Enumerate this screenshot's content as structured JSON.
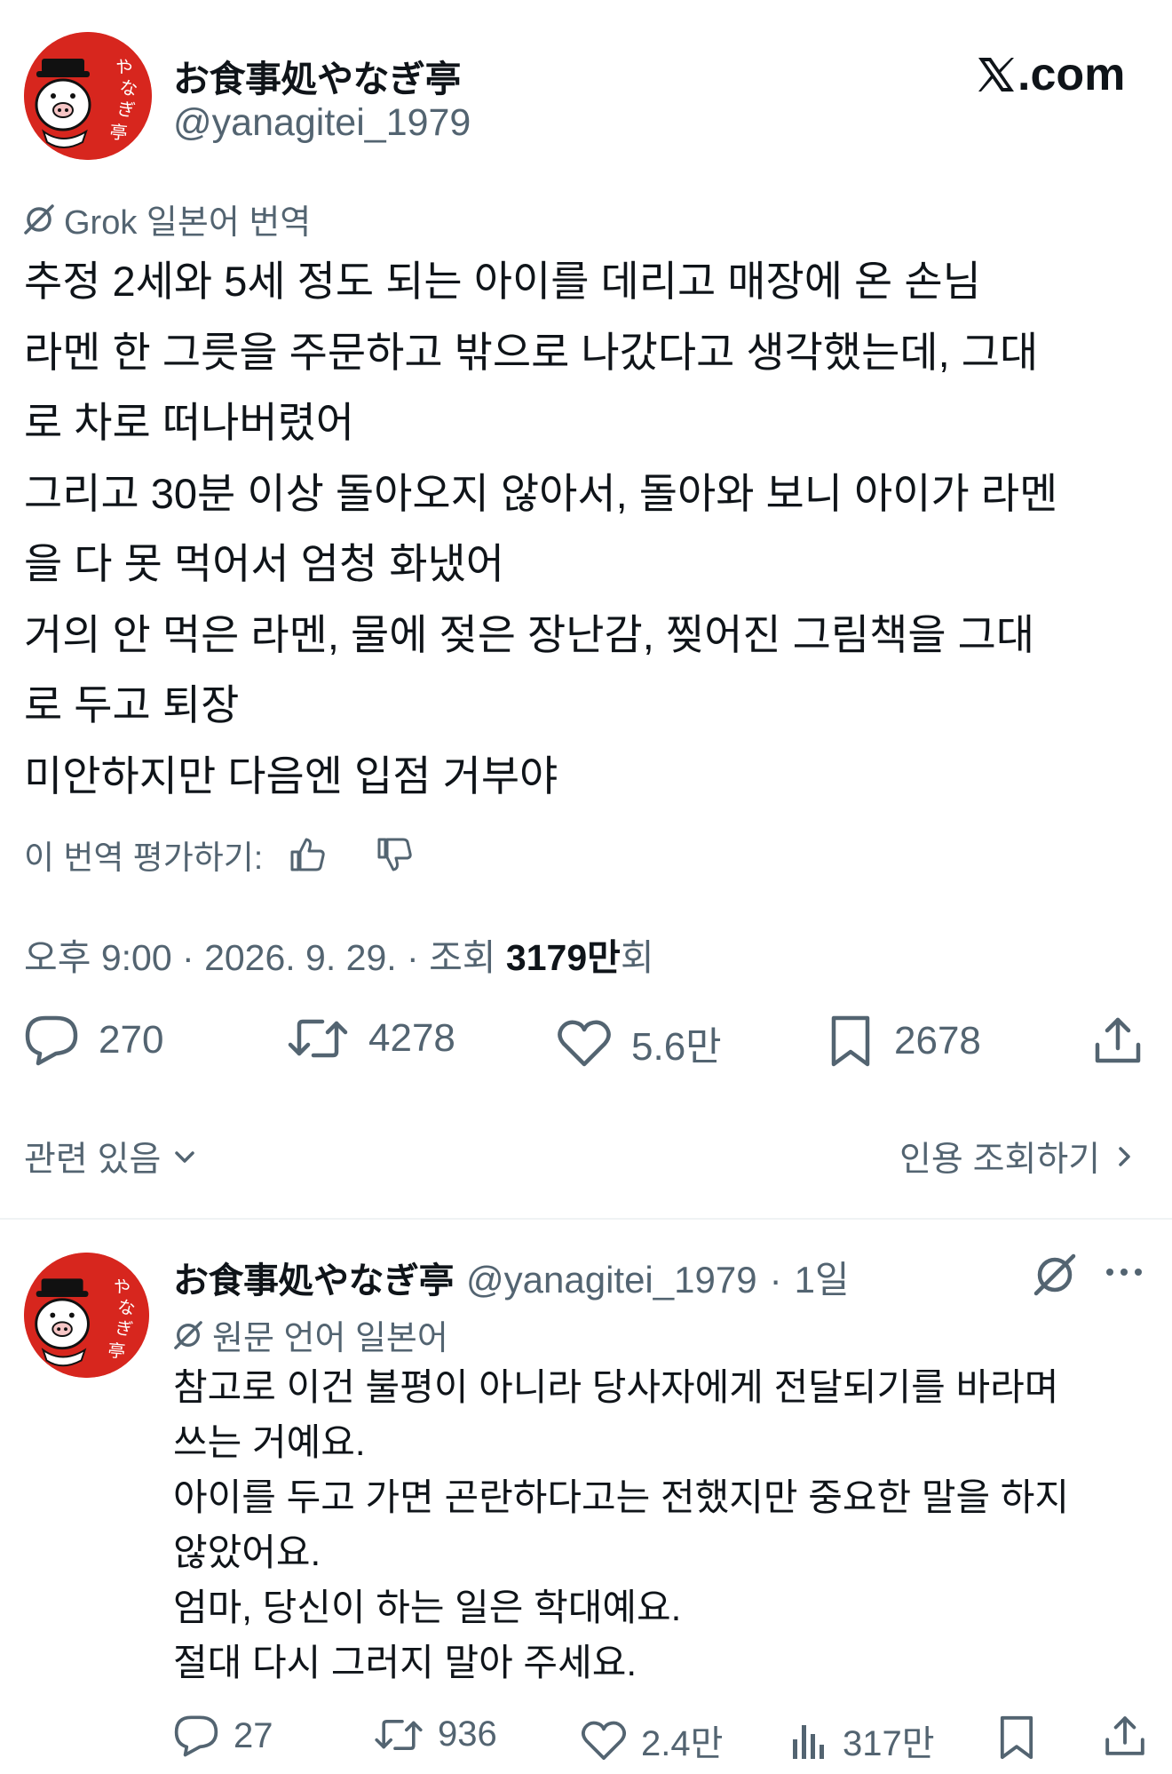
{
  "tweet": {
    "display_name": "お食事処やなぎ亭",
    "handle": "@yanagitei_1979",
    "site_label": ".com",
    "translation_label": "Grok 일본어 번역",
    "lines": [
      "추정 2세와 5세 정도 되는 아이를 데리고 매장에 온 손님",
      "라멘 한 그릇을 주문하고 밖으로 나갔다고 생각했는데, 그대",
      "로 차로 떠나버렸어",
      "그리고 30분 이상 돌아오지 않아서, 돌아와 보니 아이가 라멘",
      "을 다 못 먹어서 엄청 화냈어",
      "거의 안 먹은 라멘, 물에 젖은 장난감, 찢어진 그림책을 그대",
      "로 두고 퇴장",
      "미안하지만 다음엔 입점 거부야"
    ],
    "rate_label": "이 번역 평가하기:",
    "time": "오후 9:00 · 2026. 9. 29. · 조회 ",
    "views": "3179만",
    "views_unit": "회",
    "stats": {
      "replies": "270",
      "retweets": "4278",
      "likes": "5.6만",
      "bookmarks": "2678"
    },
    "related_label": "관련 있음",
    "quotes_label": "인용 조회하기"
  },
  "reply": {
    "display_name": "お食事処やなぎ亭",
    "handle": "@yanagitei_1979",
    "sep": "·",
    "age": "1일",
    "original_label": "원문 언어 일본어",
    "lines": [
      "참고로 이건 불평이 아니라 당사자에게 전달되기를 바라며",
      "쓰는 거예요.",
      "아이를 두고 가면 곤란하다고는 전했지만 중요한 말을 하지",
      "않았어요.",
      "엄마, 당신이 하는 일은 학대예요.",
      "절대 다시 그러지 말아 주세요."
    ],
    "stats": {
      "replies": "27",
      "retweets": "936",
      "likes": "2.4만",
      "views": "317만"
    }
  },
  "avatar_text": "やなぎ亭",
  "colors": {
    "avatar_red": "#d7261e",
    "muted": "#536471",
    "text": "#0f1419"
  },
  "icons": [
    "grok-icon",
    "thumbs-up-icon",
    "thumbs-down-icon",
    "reply-icon",
    "retweet-icon",
    "like-icon",
    "bookmark-icon",
    "share-icon",
    "chevron-down-icon",
    "chevron-right-icon",
    "more-icon",
    "views-icon",
    "x-logo-icon"
  ]
}
